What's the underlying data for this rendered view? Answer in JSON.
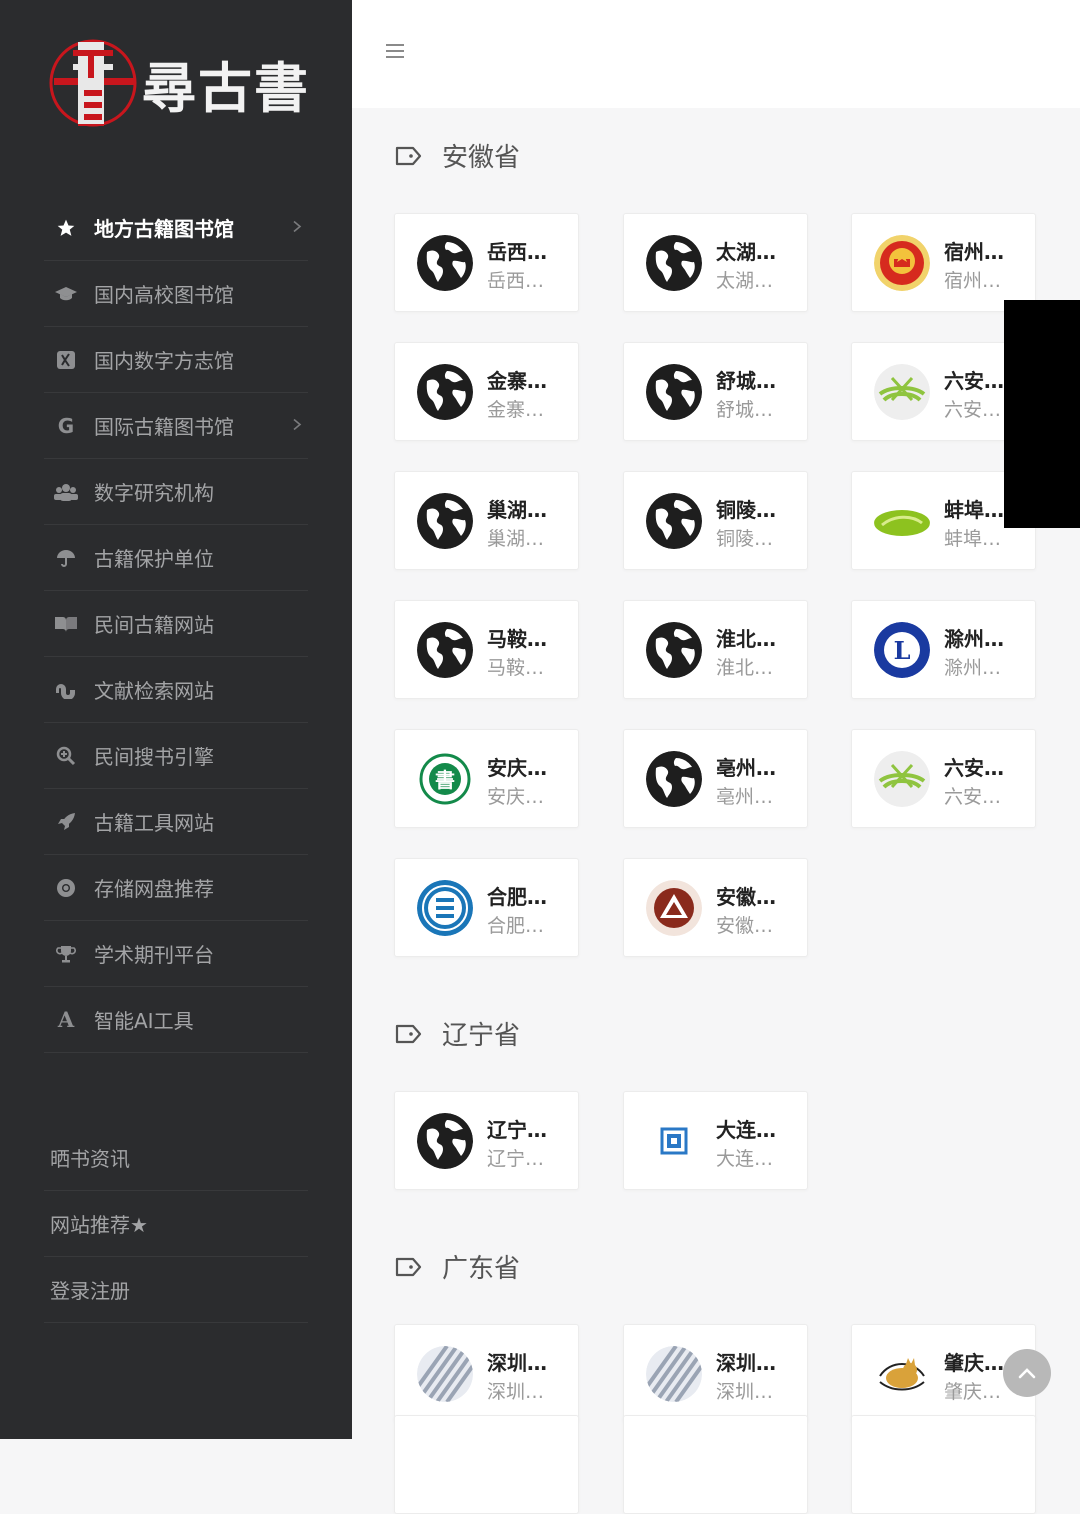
{
  "brand": {
    "logo_text": "尋古書"
  },
  "sidebar": {
    "items": [
      {
        "label": "地方古籍图书馆",
        "icon": "star-icon",
        "active": true,
        "has_arrow": true
      },
      {
        "label": "国内高校图书馆",
        "icon": "graduation-cap-icon"
      },
      {
        "label": "国内数字方志馆",
        "icon": "xing-icon"
      },
      {
        "label": "国际古籍图书馆",
        "icon": "google-icon",
        "has_arrow": true
      },
      {
        "label": "数字研究机构",
        "icon": "users-icon"
      },
      {
        "label": "古籍保护单位",
        "icon": "umbrella-icon"
      },
      {
        "label": "民间古籍网站",
        "icon": "book-open-icon"
      },
      {
        "label": "文献检索网站",
        "icon": "stumbleupon-icon"
      },
      {
        "label": "民间搜书引擎",
        "icon": "search-plus-icon"
      },
      {
        "label": "古籍工具网站",
        "icon": "rocket-icon"
      },
      {
        "label": "存储网盘推荐",
        "icon": "chrome-icon"
      },
      {
        "label": "学术期刊平台",
        "icon": "trophy-icon"
      },
      {
        "label": "智能AI工具",
        "icon": "font-a-icon"
      }
    ],
    "secondary": [
      {
        "label": "晒书资讯"
      },
      {
        "label": "网站推荐★"
      },
      {
        "label": "登录注册"
      }
    ]
  },
  "header": {
    "menu_icon": "hamburger-icon"
  },
  "sections": [
    {
      "title": "安徽省",
      "cards": [
        {
          "title": "岳西县图书馆",
          "sub": "岳西县图书馆",
          "icon": "globe-icon"
        },
        {
          "title": "太湖县图书馆",
          "sub": "太湖县图书馆",
          "icon": "globe-icon"
        },
        {
          "title": "宿州市图书馆",
          "sub": "宿州市图书馆",
          "icon": "national-emblem-icon"
        },
        {
          "title": "金寨县图书馆",
          "sub": "金寨县图书馆",
          "icon": "globe-icon"
        },
        {
          "title": "舒城县图书馆",
          "sub": "舒城县图书馆",
          "icon": "globe-icon"
        },
        {
          "title": "六安市图书馆",
          "sub": "六安市图书馆",
          "icon": "green-book-logo-icon"
        },
        {
          "title": "巢湖市图书馆",
          "sub": "巢湖市图书馆",
          "icon": "globe-icon"
        },
        {
          "title": "铜陵市图书馆",
          "sub": "铜陵市图书馆",
          "icon": "globe-icon"
        },
        {
          "title": "蚌埠市图书馆",
          "sub": "蚌埠市图书馆",
          "icon": "green-leaf-logo-icon"
        },
        {
          "title": "马鞍山市图书馆",
          "sub": "马鞍山市图书馆",
          "icon": "globe-icon"
        },
        {
          "title": "淮北市图书馆",
          "sub": "淮北市图书馆",
          "icon": "globe-icon"
        },
        {
          "title": "滁州市图书馆",
          "sub": "滁州市图书馆",
          "icon": "blue-l-logo-icon"
        },
        {
          "title": "安庆市图书馆",
          "sub": "安庆市图书馆",
          "icon": "anqing-library-logo-icon"
        },
        {
          "title": "亳州市图书馆",
          "sub": "亳州市图书馆",
          "icon": "globe-icon"
        },
        {
          "title": "六安市图书馆",
          "sub": "六安市图书馆",
          "icon": "green-book-logo-icon"
        },
        {
          "title": "合肥市图书馆",
          "sub": "合肥市图书馆",
          "icon": "hefei-library-logo-icon"
        },
        {
          "title": "安徽省图书馆",
          "sub": "安徽省图书馆",
          "icon": "anhui-library-logo-icon"
        }
      ]
    },
    {
      "title": "辽宁省",
      "cards": [
        {
          "title": "辽宁省图书馆",
          "sub": "辽宁省图书馆",
          "icon": "globe-icon"
        },
        {
          "title": "大连图书馆",
          "sub": "大连图书馆",
          "icon": "dalian-library-logo-icon"
        }
      ]
    },
    {
      "title": "广东省",
      "cards": [
        {
          "title": "深圳图书馆",
          "sub": "深圳图书馆",
          "icon": "striped-placeholder-icon"
        },
        {
          "title": "深圳大学图书馆",
          "sub": "深圳大学图书馆",
          "icon": "striped-placeholder-icon"
        },
        {
          "title": "肇庆市图书馆",
          "sub": "肇庆市图书馆",
          "icon": "cat-logo-icon"
        }
      ]
    }
  ],
  "colors": {
    "sidebar_bg": "#2b2c2e",
    "content_bg": "#f6f6f7",
    "logo_red": "#c8161d"
  }
}
